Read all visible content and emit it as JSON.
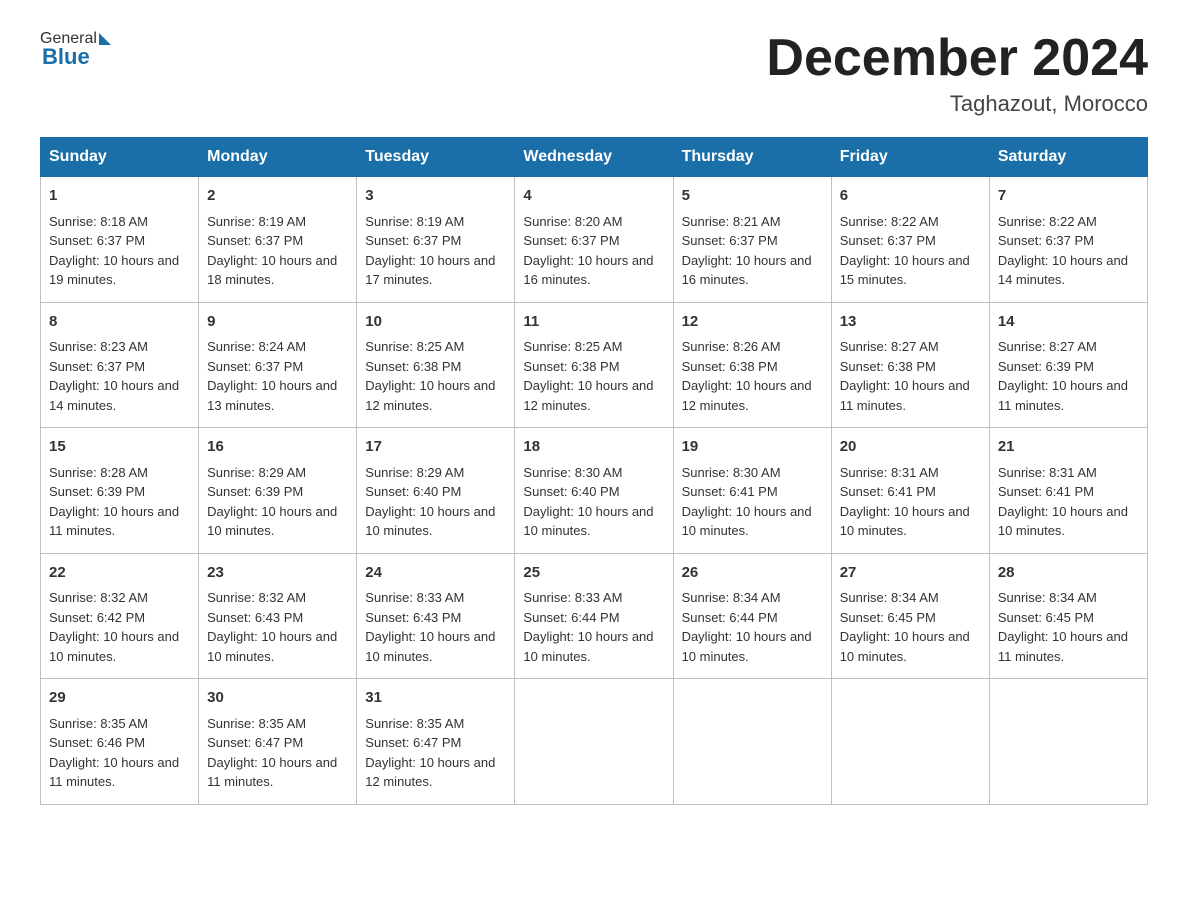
{
  "header": {
    "logo_general": "General",
    "logo_blue": "Blue",
    "month_title": "December 2024",
    "location": "Taghazout, Morocco"
  },
  "days_of_week": [
    "Sunday",
    "Monday",
    "Tuesday",
    "Wednesday",
    "Thursday",
    "Friday",
    "Saturday"
  ],
  "weeks": [
    [
      {
        "day": "1",
        "sunrise": "Sunrise: 8:18 AM",
        "sunset": "Sunset: 6:37 PM",
        "daylight": "Daylight: 10 hours and 19 minutes."
      },
      {
        "day": "2",
        "sunrise": "Sunrise: 8:19 AM",
        "sunset": "Sunset: 6:37 PM",
        "daylight": "Daylight: 10 hours and 18 minutes."
      },
      {
        "day": "3",
        "sunrise": "Sunrise: 8:19 AM",
        "sunset": "Sunset: 6:37 PM",
        "daylight": "Daylight: 10 hours and 17 minutes."
      },
      {
        "day": "4",
        "sunrise": "Sunrise: 8:20 AM",
        "sunset": "Sunset: 6:37 PM",
        "daylight": "Daylight: 10 hours and 16 minutes."
      },
      {
        "day": "5",
        "sunrise": "Sunrise: 8:21 AM",
        "sunset": "Sunset: 6:37 PM",
        "daylight": "Daylight: 10 hours and 16 minutes."
      },
      {
        "day": "6",
        "sunrise": "Sunrise: 8:22 AM",
        "sunset": "Sunset: 6:37 PM",
        "daylight": "Daylight: 10 hours and 15 minutes."
      },
      {
        "day": "7",
        "sunrise": "Sunrise: 8:22 AM",
        "sunset": "Sunset: 6:37 PM",
        "daylight": "Daylight: 10 hours and 14 minutes."
      }
    ],
    [
      {
        "day": "8",
        "sunrise": "Sunrise: 8:23 AM",
        "sunset": "Sunset: 6:37 PM",
        "daylight": "Daylight: 10 hours and 14 minutes."
      },
      {
        "day": "9",
        "sunrise": "Sunrise: 8:24 AM",
        "sunset": "Sunset: 6:37 PM",
        "daylight": "Daylight: 10 hours and 13 minutes."
      },
      {
        "day": "10",
        "sunrise": "Sunrise: 8:25 AM",
        "sunset": "Sunset: 6:38 PM",
        "daylight": "Daylight: 10 hours and 12 minutes."
      },
      {
        "day": "11",
        "sunrise": "Sunrise: 8:25 AM",
        "sunset": "Sunset: 6:38 PM",
        "daylight": "Daylight: 10 hours and 12 minutes."
      },
      {
        "day": "12",
        "sunrise": "Sunrise: 8:26 AM",
        "sunset": "Sunset: 6:38 PM",
        "daylight": "Daylight: 10 hours and 12 minutes."
      },
      {
        "day": "13",
        "sunrise": "Sunrise: 8:27 AM",
        "sunset": "Sunset: 6:38 PM",
        "daylight": "Daylight: 10 hours and 11 minutes."
      },
      {
        "day": "14",
        "sunrise": "Sunrise: 8:27 AM",
        "sunset": "Sunset: 6:39 PM",
        "daylight": "Daylight: 10 hours and 11 minutes."
      }
    ],
    [
      {
        "day": "15",
        "sunrise": "Sunrise: 8:28 AM",
        "sunset": "Sunset: 6:39 PM",
        "daylight": "Daylight: 10 hours and 11 minutes."
      },
      {
        "day": "16",
        "sunrise": "Sunrise: 8:29 AM",
        "sunset": "Sunset: 6:39 PM",
        "daylight": "Daylight: 10 hours and 10 minutes."
      },
      {
        "day": "17",
        "sunrise": "Sunrise: 8:29 AM",
        "sunset": "Sunset: 6:40 PM",
        "daylight": "Daylight: 10 hours and 10 minutes."
      },
      {
        "day": "18",
        "sunrise": "Sunrise: 8:30 AM",
        "sunset": "Sunset: 6:40 PM",
        "daylight": "Daylight: 10 hours and 10 minutes."
      },
      {
        "day": "19",
        "sunrise": "Sunrise: 8:30 AM",
        "sunset": "Sunset: 6:41 PM",
        "daylight": "Daylight: 10 hours and 10 minutes."
      },
      {
        "day": "20",
        "sunrise": "Sunrise: 8:31 AM",
        "sunset": "Sunset: 6:41 PM",
        "daylight": "Daylight: 10 hours and 10 minutes."
      },
      {
        "day": "21",
        "sunrise": "Sunrise: 8:31 AM",
        "sunset": "Sunset: 6:41 PM",
        "daylight": "Daylight: 10 hours and 10 minutes."
      }
    ],
    [
      {
        "day": "22",
        "sunrise": "Sunrise: 8:32 AM",
        "sunset": "Sunset: 6:42 PM",
        "daylight": "Daylight: 10 hours and 10 minutes."
      },
      {
        "day": "23",
        "sunrise": "Sunrise: 8:32 AM",
        "sunset": "Sunset: 6:43 PM",
        "daylight": "Daylight: 10 hours and 10 minutes."
      },
      {
        "day": "24",
        "sunrise": "Sunrise: 8:33 AM",
        "sunset": "Sunset: 6:43 PM",
        "daylight": "Daylight: 10 hours and 10 minutes."
      },
      {
        "day": "25",
        "sunrise": "Sunrise: 8:33 AM",
        "sunset": "Sunset: 6:44 PM",
        "daylight": "Daylight: 10 hours and 10 minutes."
      },
      {
        "day": "26",
        "sunrise": "Sunrise: 8:34 AM",
        "sunset": "Sunset: 6:44 PM",
        "daylight": "Daylight: 10 hours and 10 minutes."
      },
      {
        "day": "27",
        "sunrise": "Sunrise: 8:34 AM",
        "sunset": "Sunset: 6:45 PM",
        "daylight": "Daylight: 10 hours and 10 minutes."
      },
      {
        "day": "28",
        "sunrise": "Sunrise: 8:34 AM",
        "sunset": "Sunset: 6:45 PM",
        "daylight": "Daylight: 10 hours and 11 minutes."
      }
    ],
    [
      {
        "day": "29",
        "sunrise": "Sunrise: 8:35 AM",
        "sunset": "Sunset: 6:46 PM",
        "daylight": "Daylight: 10 hours and 11 minutes."
      },
      {
        "day": "30",
        "sunrise": "Sunrise: 8:35 AM",
        "sunset": "Sunset: 6:47 PM",
        "daylight": "Daylight: 10 hours and 11 minutes."
      },
      {
        "day": "31",
        "sunrise": "Sunrise: 8:35 AM",
        "sunset": "Sunset: 6:47 PM",
        "daylight": "Daylight: 10 hours and 12 minutes."
      },
      null,
      null,
      null,
      null
    ]
  ]
}
